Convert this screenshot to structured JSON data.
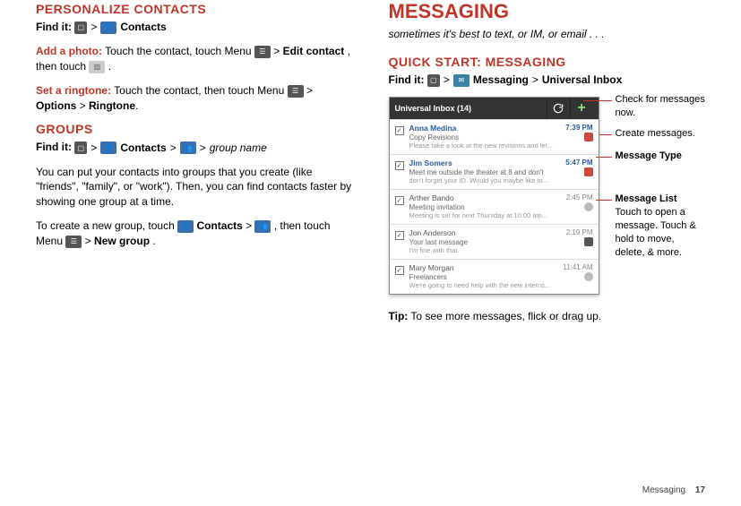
{
  "left": {
    "h_personalize": "Personalize contacts",
    "find_it_label": "Find it:",
    "contacts_label": "Contacts",
    "add_photo_label": "Add a photo:",
    "add_photo_text1": " Touch the contact, touch Menu ",
    "add_photo_sep": " > ",
    "add_photo_bold1": "Edit contact",
    "add_photo_mid": ", then touch ",
    "add_photo_end": ".",
    "set_ring_label": "Set a ringtone:",
    "set_ring_text1": " Touch the contact, then touch Menu ",
    "set_ring_sep": " > ",
    "set_ring_bold1": "Options",
    "set_ring_bold2": "Ringtone",
    "h_groups": "Groups",
    "groups_find_contacts": "Contacts",
    "groups_find_groupname": "group name",
    "groups_p1": "You can put your contacts into groups that you create (like \"friends\", \"family\", or \"work\"). Then, you can find contacts faster by showing one group at a time.",
    "groups_p2_a": "To create a new group, touch ",
    "groups_p2_contacts": "Contacts",
    "groups_p2_b": ", then touch Menu ",
    "groups_p2_newgroup": "New group",
    "groups_p2_end": "."
  },
  "right": {
    "h_messaging": "Messaging",
    "subtitle": "sometimes it's best to text, or IM, or email . . .",
    "h_quickstart": "Quick start: Messaging",
    "find_it_label": "Find it:",
    "messaging_label": "Messaging",
    "universal_inbox": "Universal Inbox",
    "tip_label": "Tip:",
    "tip_text": " To see more messages, flick or drag up."
  },
  "shot": {
    "title": "Universal Inbox (14)",
    "rows": [
      {
        "name": "Anna Medina",
        "time": "7:39 PM",
        "subject": "Copy Revisions",
        "preview": "Please take a look at the new revisions and let...",
        "unread": true,
        "type": "gmail"
      },
      {
        "name": "Jim Somers",
        "time": "5:47 PM",
        "subject": "Meet me outside the theater at 8 and don't",
        "preview": "don't forget your ID. Would you maybe like to...",
        "unread": true,
        "type": "gmail"
      },
      {
        "name": "Arther Bando",
        "time": "2:45 PM",
        "subject": "Meeting invitation",
        "preview": "Meeting is set for next Thursday at 10:00 am...",
        "unread": false,
        "type": "sync"
      },
      {
        "name": "Jon Anderson",
        "time": "2:19 PM",
        "subject": "Your last message",
        "preview": "I'm fine with that.",
        "unread": false,
        "type": "mail"
      },
      {
        "name": "Mary Morgan",
        "time": "11:41 AM",
        "subject": "Freelancers",
        "preview": "We're going to need help with the new interns...",
        "unread": false,
        "type": "sync"
      }
    ]
  },
  "callouts": {
    "c1": "Check for messages now.",
    "c2": "Create messages.",
    "c3_title": "Message Type",
    "c4_title": "Message List",
    "c4_text": "Touch to open a message. Touch & hold to move, delete, & more."
  },
  "footer": {
    "section": "Messaging",
    "page": "17"
  }
}
